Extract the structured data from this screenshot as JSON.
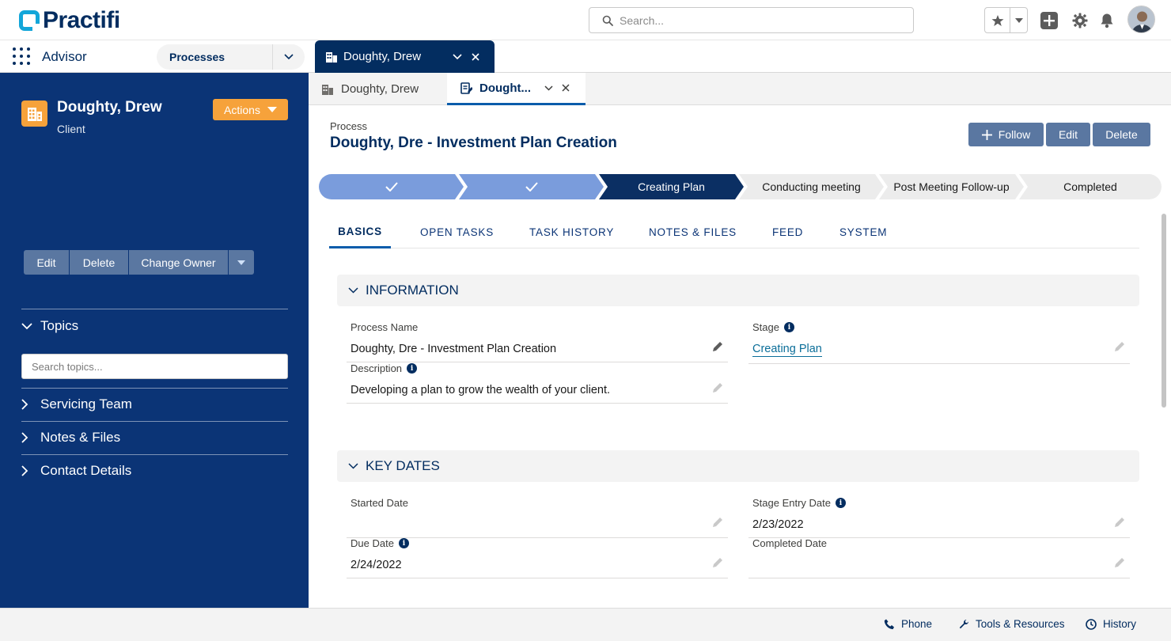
{
  "header": {
    "logo_text": "Practifi",
    "search_placeholder": "Search..."
  },
  "nav": {
    "app_name": "Advisor",
    "object_selector": "Processes",
    "workspace_tab": "Doughty, Drew"
  },
  "sidebar": {
    "client_name": "Doughty, Drew",
    "client_type": "Client",
    "actions_label": "Actions",
    "buttons": [
      "Edit",
      "Delete",
      "Change Owner"
    ],
    "sections": {
      "topics": "Topics",
      "servicing_team": "Servicing Team",
      "notes_files": "Notes & Files",
      "contact_details": "Contact Details"
    },
    "topics_placeholder": "Search topics..."
  },
  "subtabs": [
    {
      "label": "Doughty, Drew"
    },
    {
      "label": "Dought..."
    }
  ],
  "record": {
    "object_label": "Process",
    "title": "Doughty, Dre - Investment Plan Creation",
    "buttons": {
      "follow": "Follow",
      "edit": "Edit",
      "delete": "Delete"
    }
  },
  "path": {
    "steps": [
      {
        "label": "",
        "state": "complete"
      },
      {
        "label": "",
        "state": "complete"
      },
      {
        "label": "Creating Plan",
        "state": "current"
      },
      {
        "label": "Conducting meeting",
        "state": "incomplete"
      },
      {
        "label": "Post Meeting Follow-up",
        "state": "incomplete"
      },
      {
        "label": "Completed",
        "state": "incomplete"
      }
    ]
  },
  "detail_tabs": [
    "BASICS",
    "OPEN TASKS",
    "TASK HISTORY",
    "NOTES & FILES",
    "FEED",
    "SYSTEM"
  ],
  "sections": {
    "information": {
      "title": "INFORMATION",
      "process_name_label": "Process Name",
      "process_name_value": "Doughty, Dre - Investment Plan Creation",
      "stage_label": "Stage",
      "stage_value": "Creating Plan",
      "description_label": "Description",
      "description_value": "Developing a plan to grow the wealth of your client."
    },
    "key_dates": {
      "title": "KEY DATES",
      "started_label": "Started Date",
      "started_value": "",
      "stage_entry_label": "Stage Entry Date",
      "stage_entry_value": "2/23/2022",
      "due_label": "Due Date",
      "due_value": "2/24/2022",
      "completed_label": "Completed Date",
      "completed_value": ""
    }
  },
  "utility_bar": {
    "phone": "Phone",
    "tools": "Tools & Resources",
    "history": "History"
  },
  "colors": {
    "brand_navy": "#032d60",
    "sidebar_bg": "#0b3476",
    "accent_orange": "#f6a23b",
    "path_complete": "#7a9cdc",
    "path_current": "#0b2f63",
    "button_slate": "#5a77a1",
    "logo_cyan": "#13a6d9"
  }
}
